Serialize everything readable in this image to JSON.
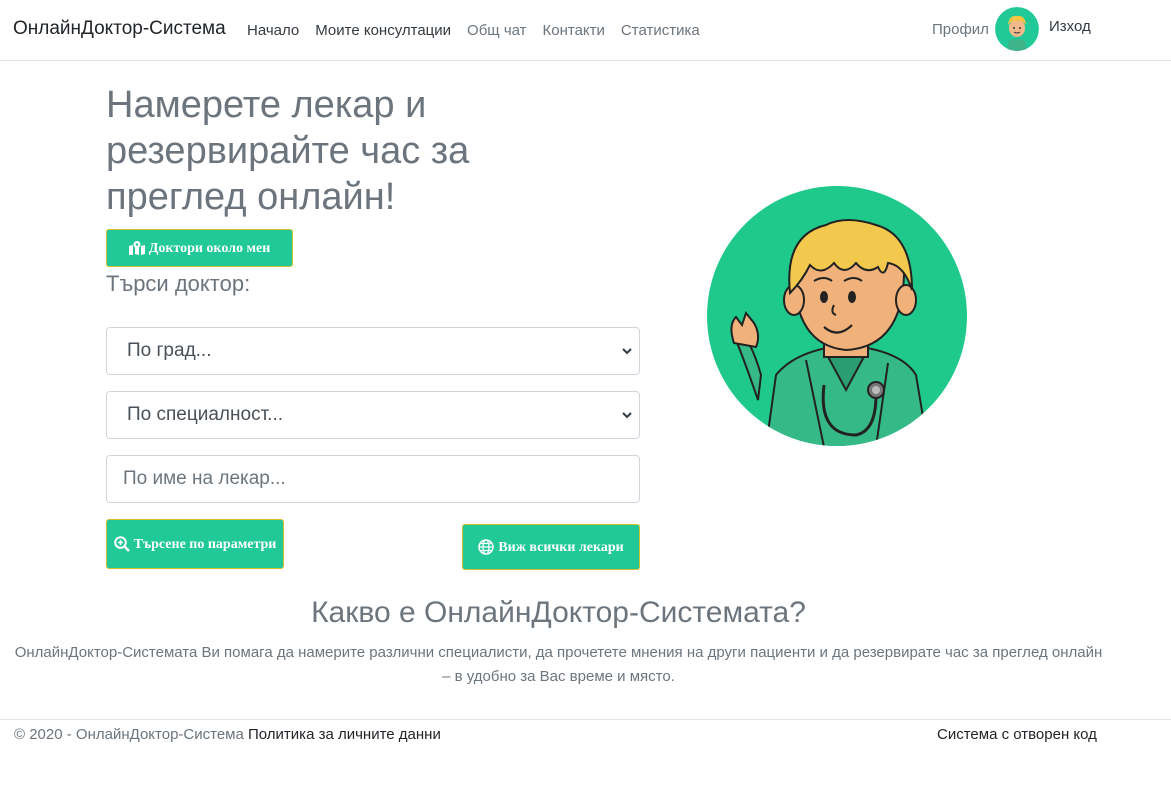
{
  "navbar": {
    "brand": "ОнлайнДоктор-Система",
    "links": [
      {
        "label": "Начало"
      },
      {
        "label": "Моите консултации"
      },
      {
        "label": "Общ чат"
      },
      {
        "label": "Контакти"
      },
      {
        "label": "Статистика"
      }
    ],
    "profile_label": "Профил",
    "logout_label": "Изход"
  },
  "hero": {
    "title": "Намерете лекар и резервирайте час за преглед онлайн!",
    "near_button": "Доктори около мен",
    "search_label": "Търси доктор:",
    "city_select": "По град...",
    "specialty_select": "По специалност...",
    "name_placeholder": "По име на лекар...",
    "search_button": "Търсене по параметри",
    "all_button": "Виж всички лекари"
  },
  "about": {
    "title": "Какво е ОнлайнДоктор-Системата?",
    "text": "ОнлайнДоктор-Системата Ви помага да намерите различни специалисти, да прочетете мнения на други пациенти и да резервирате час за преглед онлайн – в удобно за Вас време и място."
  },
  "footer": {
    "copyright": "© 2020 - ОнлайнДоктор-Система",
    "privacy_link": "Политика за личните данни",
    "open_source": "Система с отворен код"
  },
  "colors": {
    "accent": "#20c997",
    "text_muted": "#6c757d",
    "button_border": "#d4c02a"
  },
  "icons": {
    "near_button": "map-marked-icon",
    "search_button": "search-plus-icon",
    "all_button": "globe-icon",
    "select_arrow": "chevron-down-icon"
  }
}
